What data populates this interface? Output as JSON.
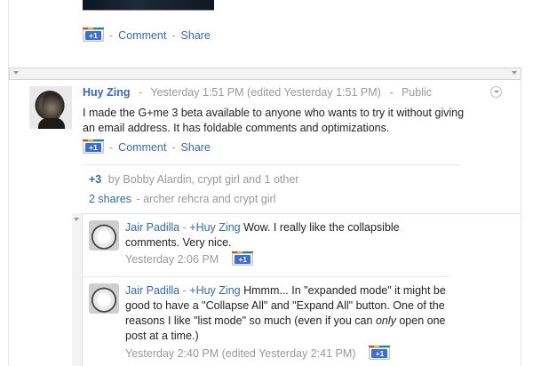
{
  "prev_post": {
    "plusone_label": "+1",
    "comment_label": "Comment",
    "share_label": "Share",
    "sep": "-"
  },
  "post": {
    "author": "Huy Zing",
    "sep1": "-",
    "timestamp": "Yesterday 1:51 PM",
    "edited": "(edited Yesterday 1:51 PM)",
    "sep2": "-",
    "visibility": "Public",
    "body": "I made the G+me 3 beta available to anyone who wants to try it without giving an email address. It has foldable comments and optimizations.",
    "plusone_label": "+1",
    "comment_label": "Comment",
    "share_label": "Share",
    "sep": "-",
    "plus_count": "+3",
    "plus_by": "by Bobby Alardin, crypt girl and 1 other",
    "shares_count": "2 shares",
    "shares_by": "- archer rehcra and crypt girl"
  },
  "comments": [
    {
      "author": "Jair Padilla",
      "sep": "-",
      "mention": "+Huy Zing",
      "text": "Wow. I really like the collapsible comments. Very nice.",
      "timestamp": "Yesterday 2:06 PM",
      "plusone_label": "+1"
    },
    {
      "author": "Jair Padilla",
      "sep": "-",
      "mention": "+Huy Zing",
      "text_a": "Hmmm... In \"expanded mode\" it might be good to have a \"Collapse All\" and \"Expand All\" button. One of the reasons I like \"list mode\" so much (even if you can",
      "text_em": "only",
      "text_b": "open one post at a time.)",
      "timestamp": "Yesterday 2:40 PM (edited Yesterday 2:41 PM)",
      "plusone_label": "+1"
    }
  ]
}
